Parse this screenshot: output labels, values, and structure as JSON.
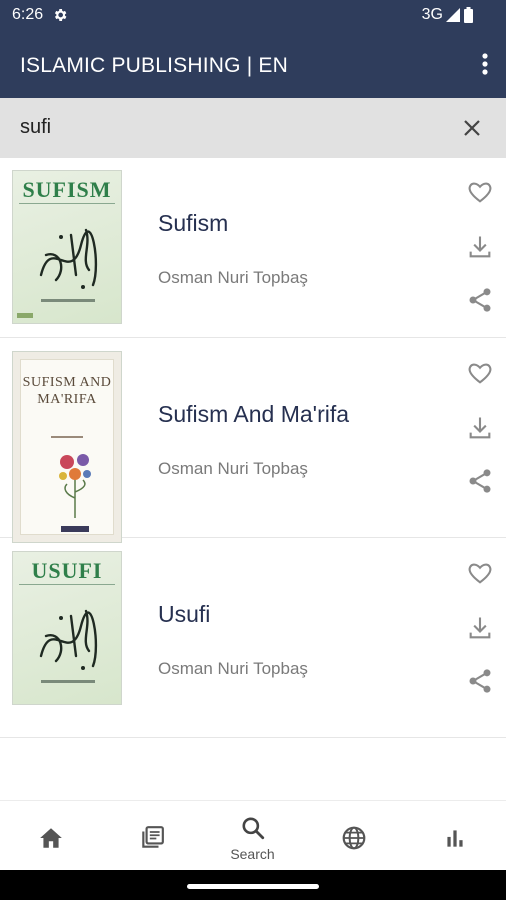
{
  "status": {
    "time": "6:26",
    "network": "3G"
  },
  "appbar": {
    "title": "ISLAMIC PUBLISHING | EN"
  },
  "search": {
    "query": "sufi"
  },
  "books": [
    {
      "title": "Sufism",
      "author": "Osman Nuri Topbaş",
      "cover_title": "SUFISM"
    },
    {
      "title": "Sufism And Ma'rifa",
      "author": "Osman Nuri Topbaş",
      "cover_title": "SUFISM AND MA'RIFA"
    },
    {
      "title": "Usufi",
      "author": "Osman Nuri Topbaş",
      "cover_title": "USUFI"
    }
  ],
  "bottom_nav": [
    {
      "icon": "home-icon",
      "label": ""
    },
    {
      "icon": "library-icon",
      "label": ""
    },
    {
      "icon": "search-icon",
      "label": "Search",
      "active": true
    },
    {
      "icon": "globe-icon",
      "label": ""
    },
    {
      "icon": "bar-chart-icon",
      "label": ""
    }
  ],
  "colors": {
    "appbar": "#2f3d5c",
    "search_bg": "#e1e1e1",
    "title_text": "#263050",
    "icon_gray": "#8a8a8a"
  }
}
